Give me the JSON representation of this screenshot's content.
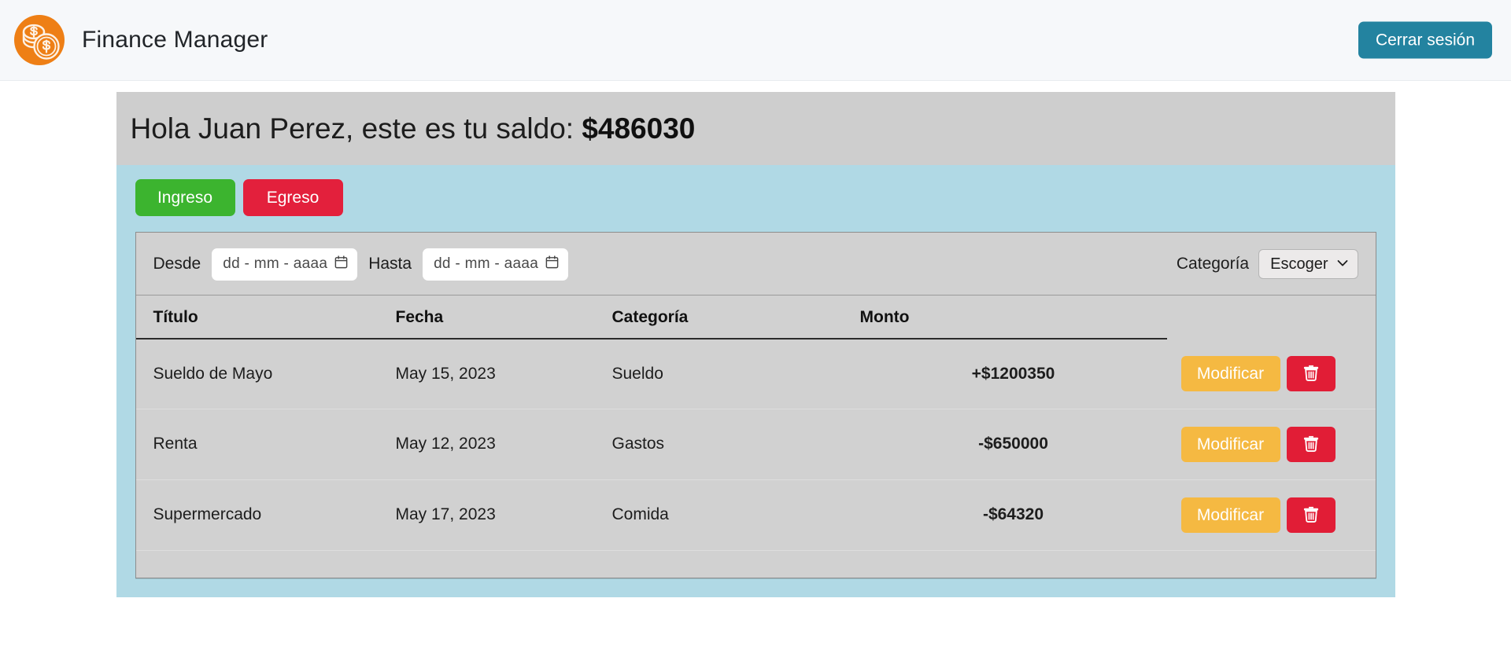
{
  "navbar": {
    "logo_icon": "coins-dollar-logo-icon",
    "brand_title": "Finance Manager",
    "logout_label": "Cerrar sesión"
  },
  "greeting": {
    "text": "Hola Juan Perez, este es tu saldo: ",
    "balance": "$486030"
  },
  "actions": {
    "income_label": "Ingreso",
    "expense_label": "Egreso"
  },
  "filters": {
    "from_label": "Desde",
    "from_value": "dd - mm - aaaa",
    "to_label": "Hasta",
    "to_value": "dd - mm - aaaa",
    "calendar_icon": "calendar-icon",
    "category_label": "Categoría",
    "category_selected": "Escoger",
    "chevron_icon": "chevron-down-icon"
  },
  "table": {
    "headers": {
      "title": "Título",
      "date": "Fecha",
      "category": "Categoría",
      "amount": "Monto",
      "actions": ""
    },
    "rows": [
      {
        "title": "Sueldo de Mayo",
        "date": "May 15, 2023",
        "category": "Sueldo",
        "amount": "+$1200350",
        "amount_sign": "positive",
        "edit_label": "Modificar",
        "delete_icon": "trash-icon"
      },
      {
        "title": "Renta",
        "date": "May 12, 2023",
        "category": "Gastos",
        "amount": "-$650000",
        "amount_sign": "negative",
        "edit_label": "Modificar",
        "delete_icon": "trash-icon"
      },
      {
        "title": "Supermercado",
        "date": "May 17, 2023",
        "category": "Comida",
        "amount": "-$64320",
        "amount_sign": "negative",
        "edit_label": "Modificar",
        "delete_icon": "trash-icon"
      }
    ]
  },
  "colors": {
    "brand_orange": "#ee7f15",
    "logout_teal": "#2383a0",
    "income_green": "#3cb42f",
    "expense_red": "#e3203c",
    "panel_blue": "#b0d9e5",
    "card_gray": "#d1d1d1",
    "edit_amber": "#f5b942",
    "delete_red": "#e11d36",
    "amount_positive": "#0d960d",
    "amount_negative": "#f21818"
  }
}
